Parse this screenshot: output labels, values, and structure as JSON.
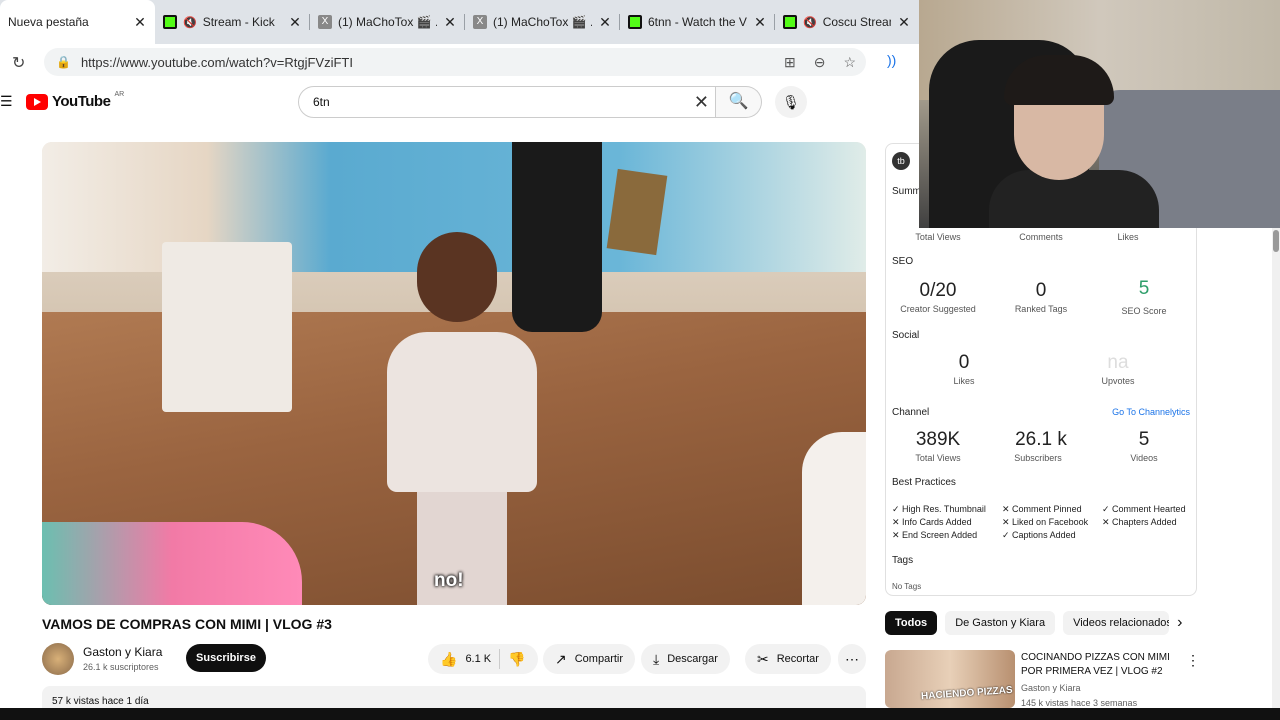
{
  "browser": {
    "tabs": [
      {
        "title": "Nueva pestaña",
        "icon": "none",
        "muted": false,
        "active": true
      },
      {
        "title": "Stream - Kick",
        "icon": "kick-icon",
        "muted": true,
        "active": false
      },
      {
        "title": "(1) MaChoTox 🎬 ...",
        "icon": "x-icon",
        "muted": false,
        "active": false
      },
      {
        "title": "(1) MaChoTox 🎬 ...",
        "icon": "x-icon",
        "muted": false,
        "active": false
      },
      {
        "title": "6tnn - Watch the V...",
        "icon": "kick-icon",
        "muted": false,
        "active": false
      },
      {
        "title": "Coscu Stream",
        "icon": "kick-icon",
        "muted": true,
        "active": false
      }
    ],
    "url": "https://www.youtube.com/watch?v=RtgjFVziFTI"
  },
  "youtube": {
    "logo_text": "YouTube",
    "country": "AR",
    "search_value": "6tn"
  },
  "video": {
    "subtitle": "no!",
    "title": "VAMOS DE COMPRAS CON MIMI | VLOG #3",
    "channel": "Gaston y Kiara",
    "subscribers": "26.1 k suscriptores",
    "subscribe_label": "Suscribirse",
    "likes": "6.1 K",
    "share_label": "Compartir",
    "download_label": "Descargar",
    "clip_label": "Recortar",
    "views_line": "57 k vistas  hace 1 día"
  },
  "tubebuddy": {
    "summary_label": "Summ",
    "summary_caps": [
      "Total Views",
      "Comments",
      "Likes"
    ],
    "seo_label": "SEO",
    "seo": [
      {
        "value": "0/20",
        "caption": "Creator Suggested"
      },
      {
        "value": "0",
        "caption": "Ranked Tags"
      },
      {
        "value": "5",
        "caption": "SEO Score"
      }
    ],
    "social_label": "Social",
    "social": [
      {
        "value": "0",
        "caption": "Likes"
      },
      {
        "value": "na",
        "caption": "Upvotes"
      }
    ],
    "channel_label": "Channel",
    "channelytics_link": "Go To Channelytics",
    "channel_stats": [
      {
        "value": "389K",
        "caption": "Total Views"
      },
      {
        "value": "26.1 k",
        "caption": "Subscribers"
      },
      {
        "value": "5",
        "caption": "Videos"
      }
    ],
    "best_practices_label": "Best Practices",
    "best_practices": [
      {
        "text": "✓ High Res. Thumbnail"
      },
      {
        "text": "✕ Comment Pinned"
      },
      {
        "text": "✓ Comment Hearted"
      },
      {
        "text": "✕ Info Cards Added"
      },
      {
        "text": "✕ Liked on Facebook"
      },
      {
        "text": "✕ Chapters Added"
      },
      {
        "text": "✕ End Screen Added"
      },
      {
        "text": "✓ Captions Added"
      }
    ],
    "tags_label": "Tags",
    "no_tags": "No Tags"
  },
  "chips": [
    "Todos",
    "De Gaston y Kiara",
    "Videos relacionados"
  ],
  "recommendation": {
    "thumb_text": "HACIENDO PIZZAS",
    "title": "COCINANDO PIZZAS CON MIMI POR PRIMERA VEZ | VLOG #2",
    "channel": "Gaston y Kiara",
    "meta": "145 k vistas  hace 3 semanas"
  },
  "colors": {
    "youtube_red": "#ff0000",
    "kick_green": "#53fc18",
    "seo_green": "#2e9e6a"
  }
}
